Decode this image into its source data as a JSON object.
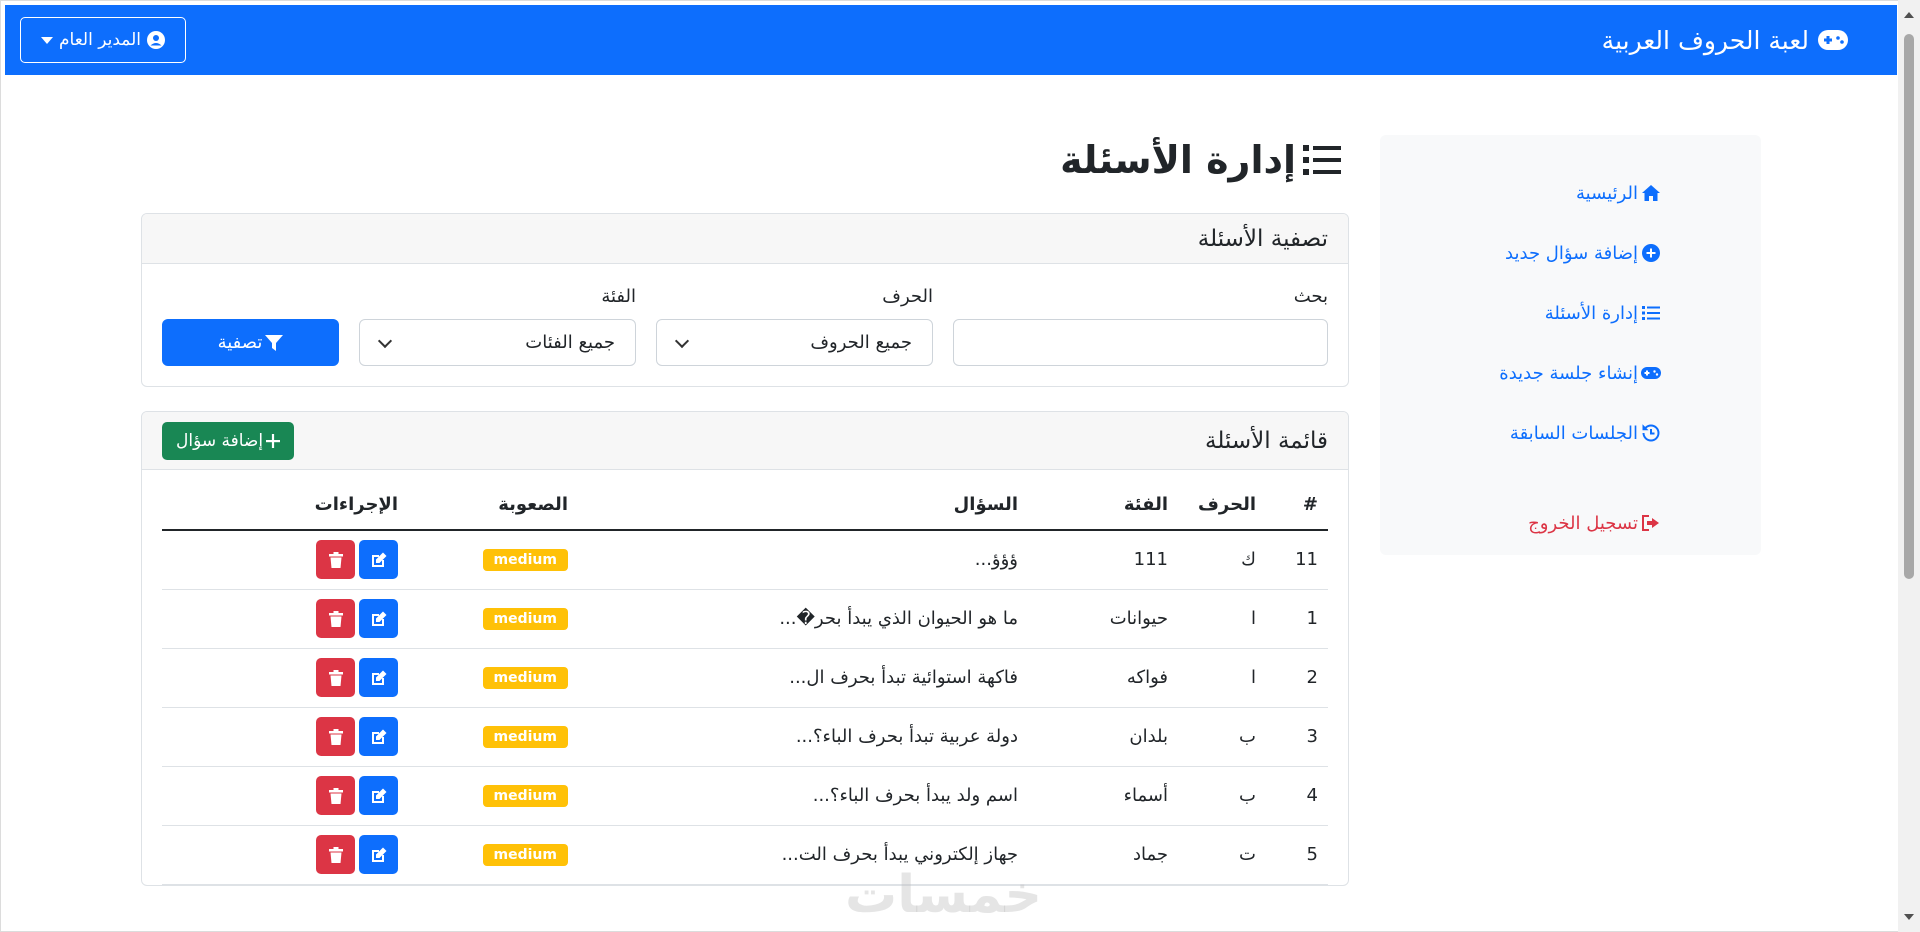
{
  "navbar": {
    "brand": "لعبة الحروف العربية",
    "brand_icon": "gamepad-icon",
    "user_label": "المدير العام",
    "user_icon": "user-circle-icon",
    "color": "#0d6efd"
  },
  "sidebar": {
    "items": [
      {
        "label": "الرئيسية",
        "icon": "home-icon"
      },
      {
        "label": "إضافة سؤال جديد",
        "icon": "plus-circle-icon"
      },
      {
        "label": "إدارة الأسئلة",
        "icon": "list-icon"
      },
      {
        "label": "إنشاء جلسة جديدة",
        "icon": "gamepad-icon"
      },
      {
        "label": "الجلسات السابقة",
        "icon": "history-icon"
      }
    ],
    "logout": {
      "label": "تسجيل الخروج",
      "icon": "sign-out-icon"
    }
  },
  "main": {
    "title": "إدارة الأسئلة",
    "filter": {
      "header": "تصفية الأسئلة",
      "search_label": "بحث",
      "search_value": "",
      "letter_label": "الحرف",
      "letter_selected": "جميع الحروف",
      "category_label": "الفئة",
      "category_selected": "جميع الفئات",
      "submit_label": "تصفية"
    },
    "list": {
      "header": "قائمة الأسئلة",
      "add_label": "إضافة سؤال",
      "columns": [
        "#",
        "الحرف",
        "الفئة",
        "السؤال",
        "الصعوبة",
        "الإجراءات"
      ],
      "rows": [
        {
          "id": "11",
          "letter": "ك",
          "category": "111",
          "question": "ؤؤؤ...",
          "difficulty": "medium"
        },
        {
          "id": "1",
          "letter": "ا",
          "category": "حيوانات",
          "question": "ما هو الحيوان الذي يبدأ بحر�...",
          "difficulty": "medium"
        },
        {
          "id": "2",
          "letter": "ا",
          "category": "فواكه",
          "question": "فاكهة استوائية تبدأ بحرف ال...",
          "difficulty": "medium"
        },
        {
          "id": "3",
          "letter": "ب",
          "category": "بلدان",
          "question": "دولة عربية تبدأ بحرف الباء؟...",
          "difficulty": "medium"
        },
        {
          "id": "4",
          "letter": "ب",
          "category": "أسماء",
          "question": "اسم ولد يبدأ بحرف الباء؟...",
          "difficulty": "medium"
        },
        {
          "id": "5",
          "letter": "ت",
          "category": "جماد",
          "question": "جهاز إلكتروني يبدأ بحرف الت...",
          "difficulty": "medium"
        }
      ]
    }
  },
  "watermark": "خمسات",
  "colors": {
    "primary": "#0d6efd",
    "success": "#198754",
    "danger": "#dc3545",
    "warning": "#ffc107"
  }
}
